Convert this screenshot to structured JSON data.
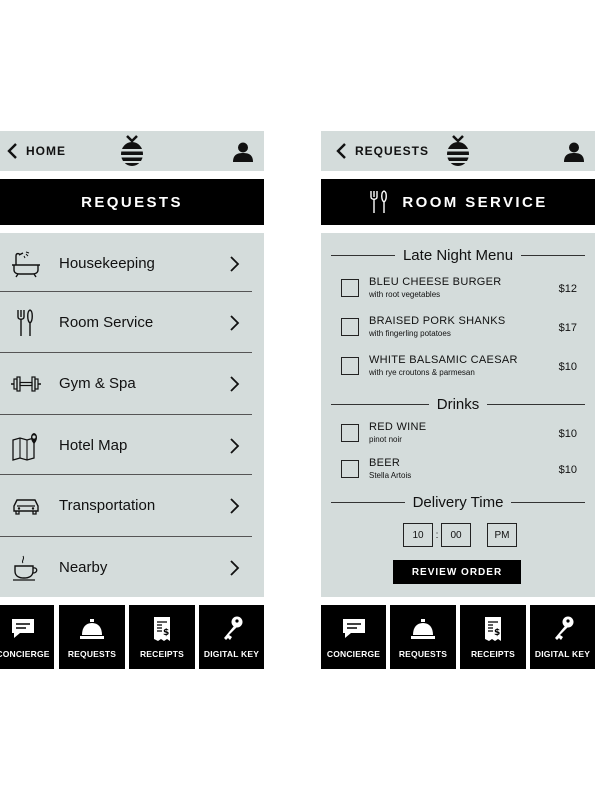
{
  "left_screen": {
    "back_label": "HOME",
    "title": "REQUESTS",
    "items": [
      {
        "label": "Housekeeping",
        "icon": "bathtub-icon"
      },
      {
        "label": "Room Service",
        "icon": "utensils-icon"
      },
      {
        "label": "Gym & Spa",
        "icon": "dumbbell-icon"
      },
      {
        "label": "Hotel Map",
        "icon": "map-icon"
      },
      {
        "label": "Transportation",
        "icon": "car-icon"
      },
      {
        "label": "Nearby",
        "icon": "coffee-cup-icon"
      }
    ]
  },
  "right_screen": {
    "back_label": "REQUESTS",
    "title": "ROOM SERVICE",
    "sections": {
      "late_night": "Late Night Menu",
      "drinks": "Drinks",
      "delivery": "Delivery Time"
    },
    "menu_items": [
      {
        "name": "BLEU CHEESE BURGER",
        "desc": "with root vegetables",
        "price": "$12"
      },
      {
        "name": "BRAISED PORK SHANKS",
        "desc": "with fingerling potatoes",
        "price": "$17"
      },
      {
        "name": "WHITE BALSAMIC CAESAR",
        "desc": "with rye croutons & parmesan",
        "price": "$10"
      }
    ],
    "drink_items": [
      {
        "name": "RED WINE",
        "desc": "pinot noir",
        "price": "$10"
      },
      {
        "name": "BEER",
        "desc": "Stella Artois",
        "price": "$10"
      }
    ],
    "delivery_time": {
      "hour": "10",
      "separator": ":",
      "minute": "00",
      "period": "PM"
    },
    "review_button": "REVIEW ORDER"
  },
  "tabs": [
    {
      "label": "CONCIERGE",
      "icon": "chat-bubble-icon"
    },
    {
      "label": "REQUESTS",
      "icon": "service-bell-icon"
    },
    {
      "label": "RECEIPTS",
      "icon": "receipt-icon"
    },
    {
      "label": "DIGITAL KEY",
      "icon": "key-icon"
    }
  ],
  "colors": {
    "panel": "#d4dcdb",
    "bar": "#000000",
    "text": "#111111"
  }
}
